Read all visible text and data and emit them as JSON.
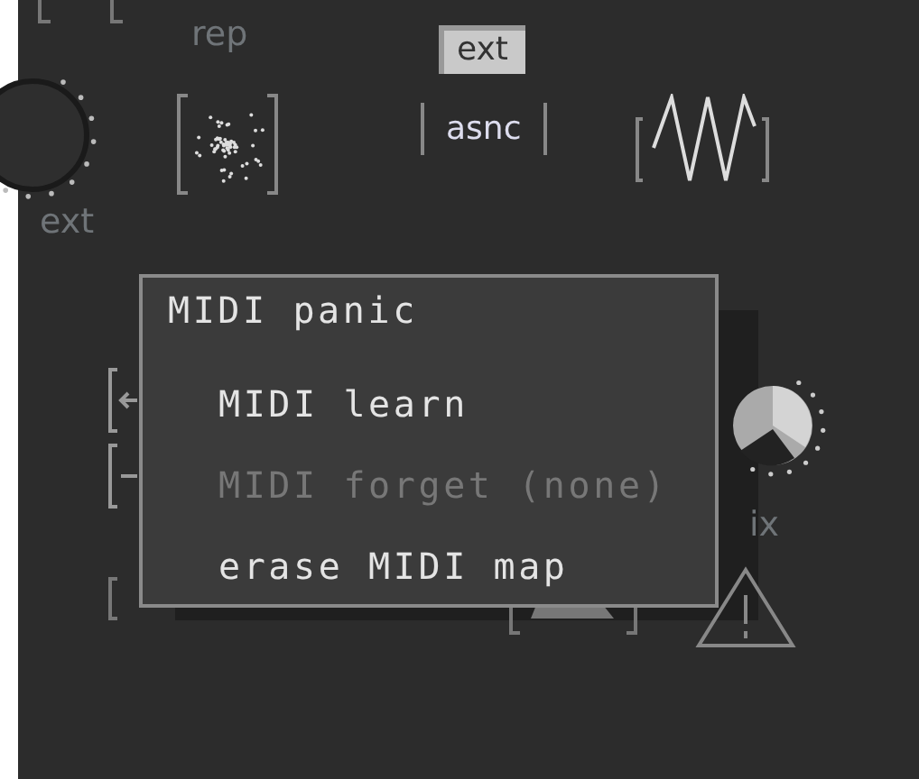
{
  "panel": {
    "rep_label": "rep",
    "knob_label": "ext",
    "sync_toggles": [
      {
        "label": "ext",
        "selected": true
      },
      {
        "label": "asnc",
        "selected": false
      }
    ],
    "mix_label_visible": "ix"
  },
  "context_menu": {
    "items": [
      {
        "label": "MIDI panic",
        "indented": false,
        "disabled": false
      },
      {
        "label": "MIDI learn",
        "indented": true,
        "disabled": false
      },
      {
        "label": "MIDI forget (none)",
        "indented": true,
        "disabled": true
      },
      {
        "label": "erase MIDI map",
        "indented": true,
        "disabled": false
      }
    ]
  }
}
